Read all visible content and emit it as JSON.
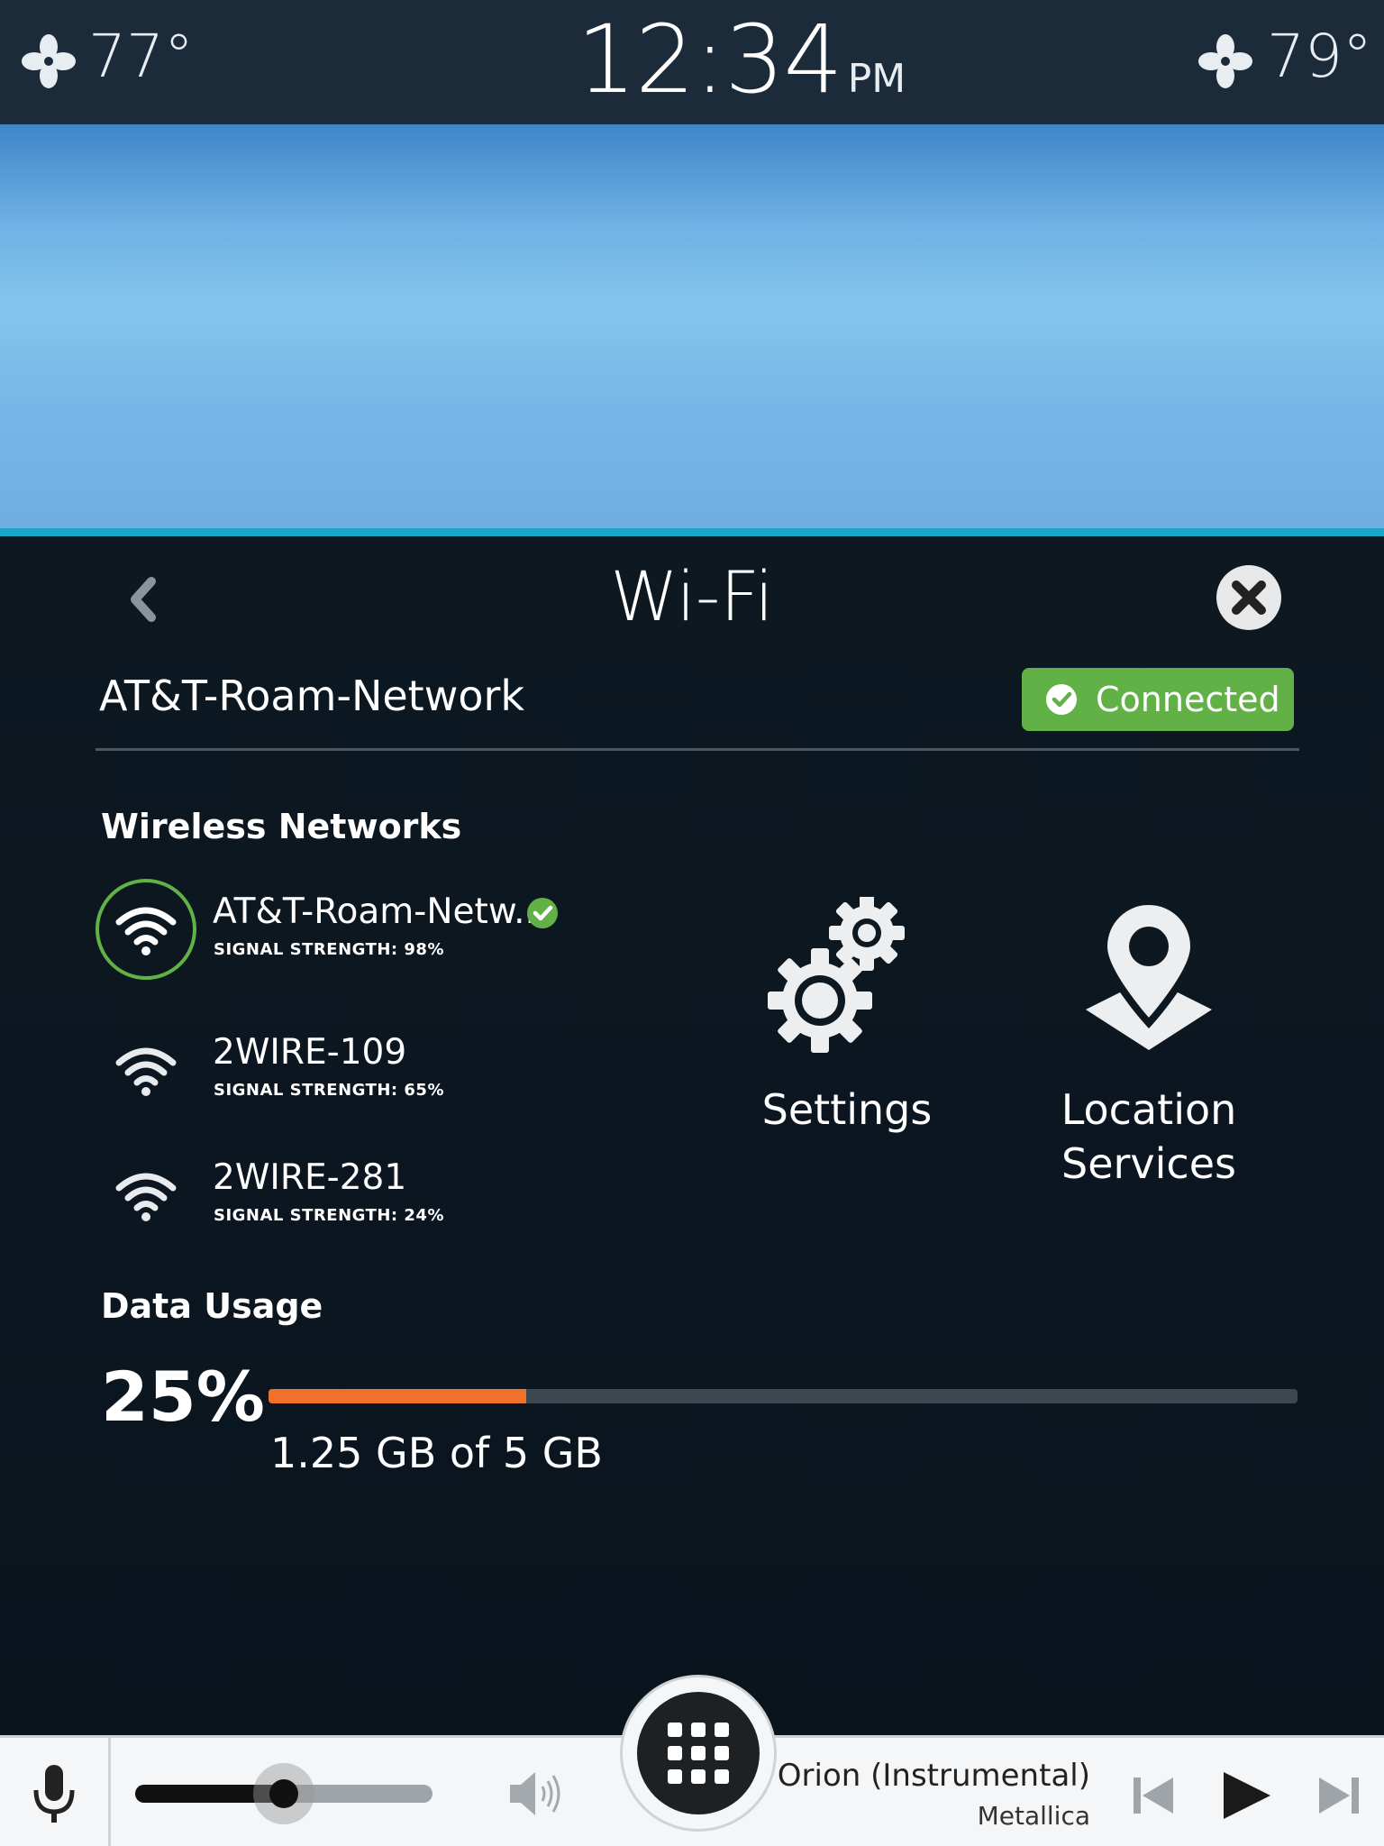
{
  "status_bar": {
    "left_temp": "77°",
    "time": "12:34",
    "ampm": "PM",
    "right_temp": "79°"
  },
  "panel": {
    "title": "Wi-Fi",
    "current_network": "AT&T-Roam-Network",
    "connected_label": "Connected"
  },
  "wireless": {
    "heading": "Wireless Networks",
    "networks": [
      {
        "name": "AT&T-Roam-Netw...",
        "signal": "SIGNAL STRENGTH: 98%",
        "active": true
      },
      {
        "name": "2WIRE-109",
        "signal": "SIGNAL STRENGTH: 65%",
        "active": false
      },
      {
        "name": "2WIRE-281",
        "signal": "SIGNAL STRENGTH: 24%",
        "active": false
      }
    ]
  },
  "tiles": {
    "settings_label": "Settings",
    "location_label_line1": "Location",
    "location_label_line2": "Services"
  },
  "data_usage": {
    "heading": "Data Usage",
    "percent_text": "25%",
    "fraction": 0.25,
    "detail": "1.25 GB of 5 GB"
  },
  "media": {
    "volume_fraction": 0.5,
    "track_title": "Orion (Instrumental)",
    "artist": "Metallica"
  },
  "icons": {
    "fan": "fan-icon",
    "back": "chevron-left-icon",
    "close": "close-circle-icon",
    "check": "check-circle-icon",
    "wifi": "wifi-icon",
    "settings": "gears-icon",
    "location": "map-pin-icon",
    "mic": "microphone-icon",
    "volume": "speaker-icon",
    "home": "app-grid-icon",
    "prev": "skip-previous-icon",
    "play": "play-icon",
    "next": "skip-next-icon"
  },
  "colors": {
    "accent_green": "#62b146",
    "usage_orange": "#f0712c",
    "panel_bg": "#0b1620",
    "status_bg": "#1c2b3a",
    "sky_blue": "#7fbfea"
  }
}
